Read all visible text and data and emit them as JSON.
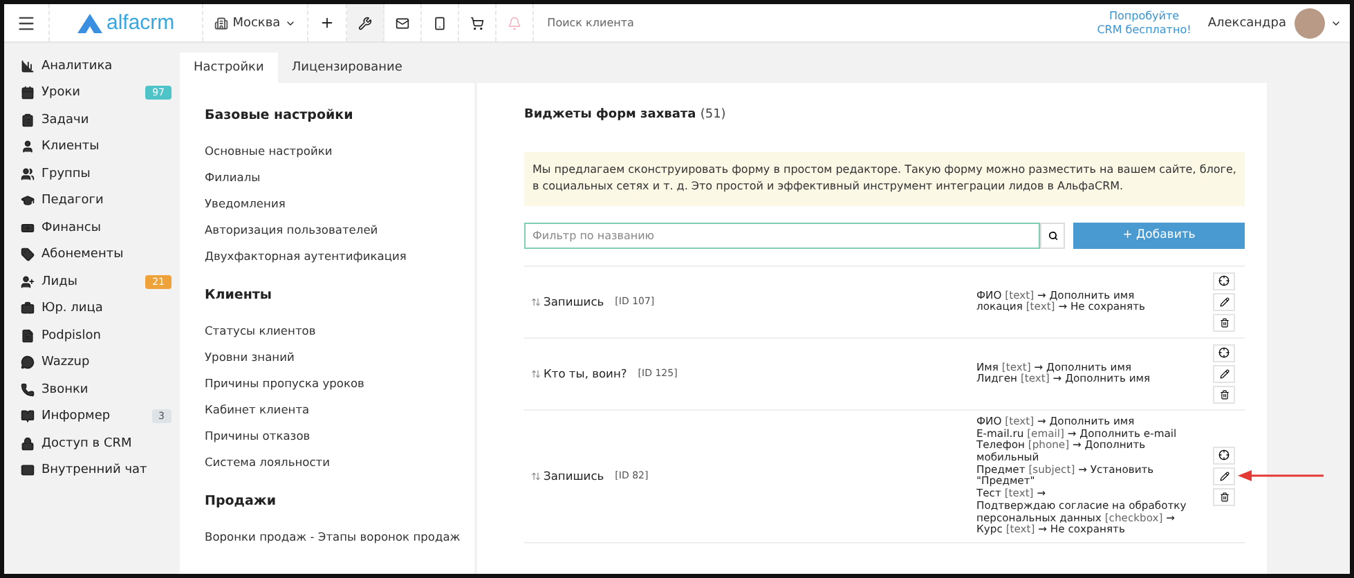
{
  "topbar": {
    "logo": "alfacrm",
    "branch": "Москва",
    "search": {
      "placeholder": "Поиск клиента"
    },
    "promo": [
      "Попробуйте",
      "CRM бесплатно!"
    ],
    "user": "Александра"
  },
  "sidebar": {
    "items": [
      {
        "label": "Аналитика"
      },
      {
        "label": "Уроки",
        "badge": "97",
        "color": "#4fc4c8"
      },
      {
        "label": "Задачи"
      },
      {
        "label": "Клиенты"
      },
      {
        "label": "Группы"
      },
      {
        "label": "Педагоги"
      },
      {
        "label": "Финансы"
      },
      {
        "label": "Абонементы"
      },
      {
        "label": "Лиды",
        "badge": "21",
        "color": "#f0a23a"
      },
      {
        "label": "Юр. лица"
      },
      {
        "label": "Podpislon"
      },
      {
        "label": "Wazzup"
      },
      {
        "label": "Звонки"
      },
      {
        "label": "Информер",
        "badge": "3",
        "color": "#dde3e6"
      },
      {
        "label": "Доступ в CRM"
      },
      {
        "label": "Внутренний чат"
      }
    ]
  },
  "tabs": [
    {
      "label": "Настройки",
      "selected": true
    },
    {
      "label": "Лицензирование",
      "selected": false
    }
  ],
  "settings_menu": [
    {
      "heading": "Базовые настройки",
      "items": [
        "Основные настройки",
        "Филиалы",
        "Уведомления",
        "Авторизация пользователей",
        "Двухфакторная аутентификация"
      ]
    },
    {
      "heading": "Клиенты",
      "items": [
        "Статусы клиентов",
        "Уровни знаний",
        "Причины пропуска уроков",
        "Кабинет клиента",
        "Причины отказов",
        "Система лояльности"
      ]
    },
    {
      "heading": "Продажи",
      "items": [
        "Воронки продаж - Этапы воронок продаж"
      ]
    }
  ],
  "content": {
    "title": "Виджеты форм захвата",
    "count": "(51)",
    "notice": "Мы предлагаем сконструировать форму в простом редакторе. Такую форму можно разместить на вашем сайте, блоге, в социальных сетях и т. д. Это простой и эффективный инструмент интеграции лидов в АльфаCRM.",
    "filter": {
      "placeholder": "Фильтр по названию"
    },
    "add_button": "+ Добавить",
    "widgets": [
      {
        "name": "Запишись",
        "id": "[ID 107]",
        "fields": [
          {
            "field": "ФИО",
            "type": "[text]",
            "target": "→ Дополнить имя"
          },
          {
            "field": "локация",
            "type": "[text]",
            "target": "→ Не сохранять"
          }
        ]
      },
      {
        "name": "Кто ты, воин?",
        "id": "[ID 125]",
        "fields": [
          {
            "field": "Имя",
            "type": "[text]",
            "target": "→ Дополнить имя"
          },
          {
            "field": "Лидген",
            "type": "[text]",
            "target": "→ Дополнить имя"
          }
        ]
      },
      {
        "name": "Запишись",
        "id": "[ID 82]",
        "annotated": true,
        "fields": [
          {
            "field": "ФИО",
            "type": "[text]",
            "target": "→ Дополнить имя"
          },
          {
            "field": "E-mail.ru",
            "type": "[email]",
            "target": "→ Дополнить e-mail"
          },
          {
            "field": "Телефон",
            "type": "[phone]",
            "target": "→ Дополнить мобильный"
          },
          {
            "field": "Предмет",
            "type": "[subject]",
            "target": "→ Установить \"Предмет\""
          },
          {
            "field": "Тест",
            "type": "[text]",
            "target": "→"
          },
          {
            "field": "Подтверждаю согласие на обработку персональных данных",
            "type": "[checkbox]",
            "target": "→"
          },
          {
            "field": "Курс",
            "type": "[text]",
            "target": "→ Не сохранять"
          }
        ]
      }
    ]
  }
}
